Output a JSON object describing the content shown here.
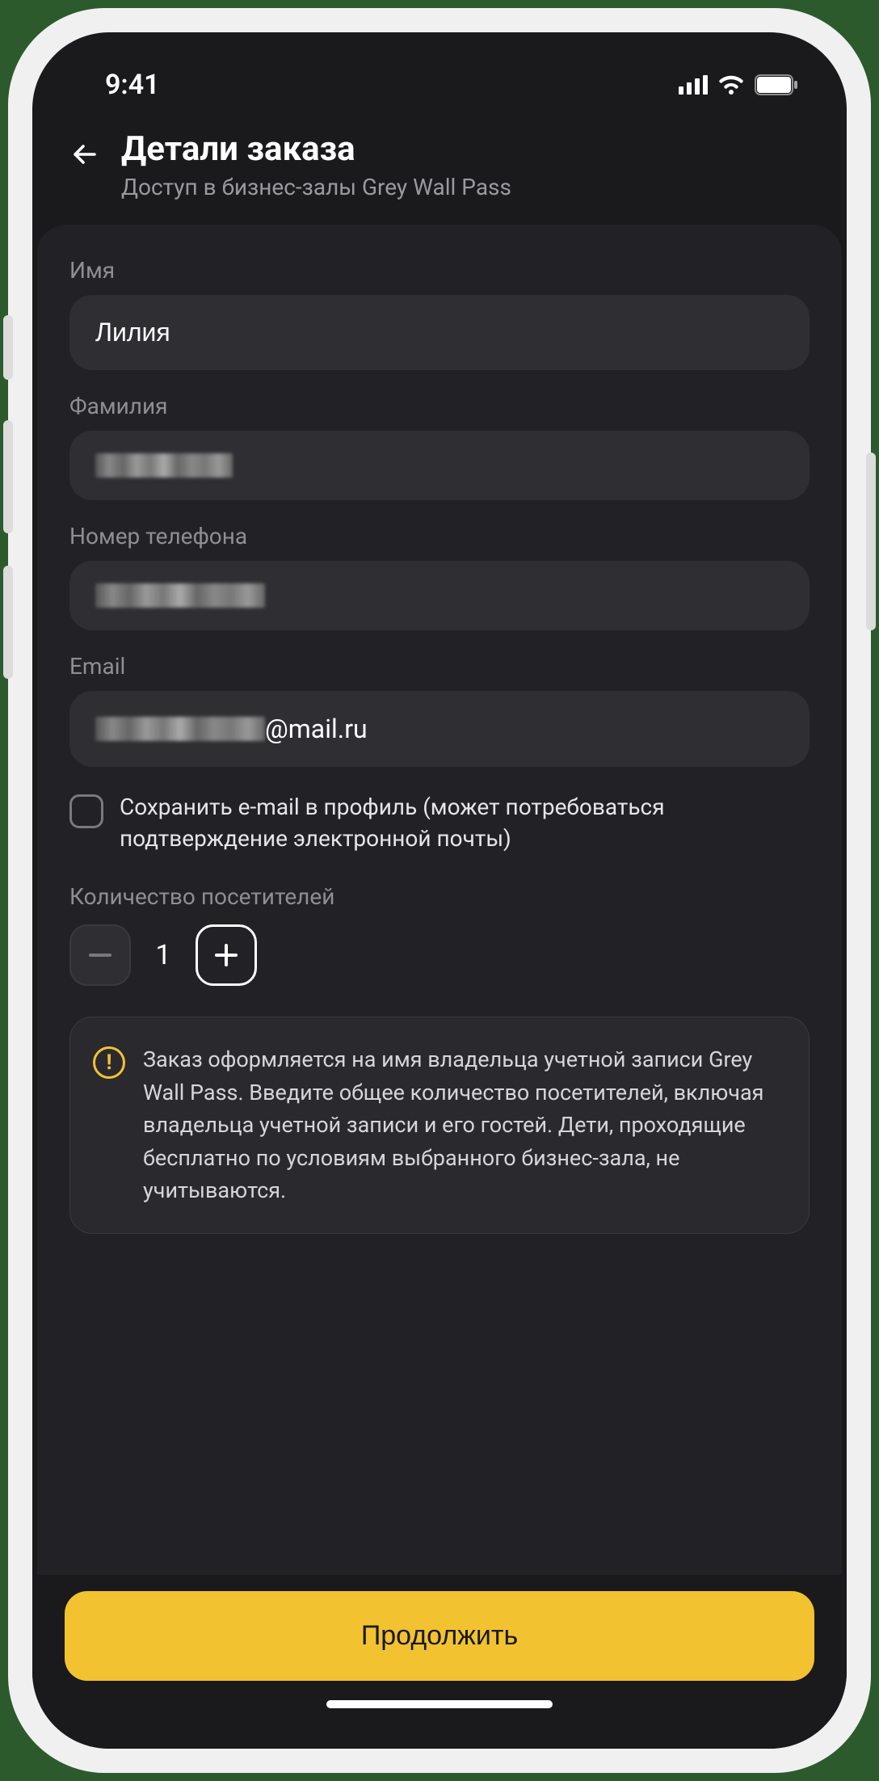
{
  "status": {
    "time": "9:41"
  },
  "header": {
    "title": "Детали заказа",
    "subtitle": "Доступ в бизнес-залы Grey Wall Pass"
  },
  "form": {
    "first_name": {
      "label": "Имя",
      "value": "Лилия"
    },
    "last_name": {
      "label": "Фамилия",
      "value_redacted": true
    },
    "phone": {
      "label": "Номер телефона",
      "value_redacted": true
    },
    "email": {
      "label": "Email",
      "value_suffix": "@mail.ru",
      "value_prefix_redacted": true
    },
    "save_email_checkbox": {
      "label": "Сохранить e-mail в профиль (может потребоваться подтверждение электронной почты)",
      "checked": false
    },
    "visitors": {
      "label": "Количество посетителей",
      "value": "1"
    }
  },
  "notice": {
    "text": "Заказ оформляется на имя владельца учетной записи Grey Wall Pass. Введите общее количество посетителей, включая владельца учетной записи и его гостей. Дети, проходящие бесплатно по условиям выбранного бизнес-зала, не учитываются."
  },
  "footer": {
    "continue_label": "Продолжить"
  }
}
